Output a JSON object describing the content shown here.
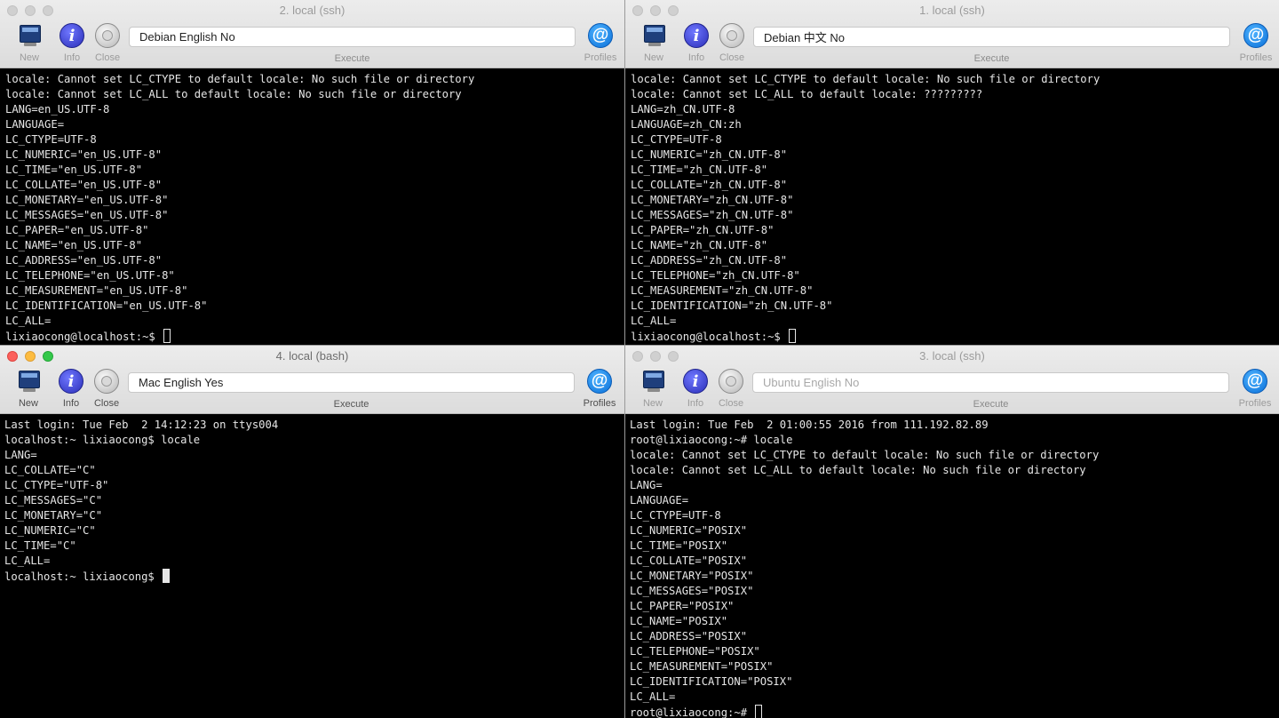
{
  "toolbar_labels": {
    "new": "New",
    "info": "Info",
    "close": "Close",
    "execute": "Execute",
    "profiles": "Profiles",
    "profiles_glyph": "@",
    "info_glyph": "i"
  },
  "windows": {
    "top_left": {
      "title": "2. local (ssh)",
      "command_value": "Debian English No",
      "command_placeholder": "",
      "lines": [
        "locale: Cannot set LC_CTYPE to default locale: No such file or directory",
        "locale: Cannot set LC_ALL to default locale: No such file or directory",
        "LANG=en_US.UTF-8",
        "LANGUAGE=",
        "LC_CTYPE=UTF-8",
        "LC_NUMERIC=\"en_US.UTF-8\"",
        "LC_TIME=\"en_US.UTF-8\"",
        "LC_COLLATE=\"en_US.UTF-8\"",
        "LC_MONETARY=\"en_US.UTF-8\"",
        "LC_MESSAGES=\"en_US.UTF-8\"",
        "LC_PAPER=\"en_US.UTF-8\"",
        "LC_NAME=\"en_US.UTF-8\"",
        "LC_ADDRESS=\"en_US.UTF-8\"",
        "LC_TELEPHONE=\"en_US.UTF-8\"",
        "LC_MEASUREMENT=\"en_US.UTF-8\"",
        "LC_IDENTIFICATION=\"en_US.UTF-8\"",
        "LC_ALL="
      ],
      "prompt": "lixiaocong@localhost:~$ "
    },
    "top_right": {
      "title": "1. local (ssh)",
      "command_value": "Debian 中文 No",
      "command_placeholder": "",
      "lines": [
        "locale: Cannot set LC_CTYPE to default locale: No such file or directory",
        "locale: Cannot set LC_ALL to default locale: ?????????",
        "LANG=zh_CN.UTF-8",
        "LANGUAGE=zh_CN:zh",
        "LC_CTYPE=UTF-8",
        "LC_NUMERIC=\"zh_CN.UTF-8\"",
        "LC_TIME=\"zh_CN.UTF-8\"",
        "LC_COLLATE=\"zh_CN.UTF-8\"",
        "LC_MONETARY=\"zh_CN.UTF-8\"",
        "LC_MESSAGES=\"zh_CN.UTF-8\"",
        "LC_PAPER=\"zh_CN.UTF-8\"",
        "LC_NAME=\"zh_CN.UTF-8\"",
        "LC_ADDRESS=\"zh_CN.UTF-8\"",
        "LC_TELEPHONE=\"zh_CN.UTF-8\"",
        "LC_MEASUREMENT=\"zh_CN.UTF-8\"",
        "LC_IDENTIFICATION=\"zh_CN.UTF-8\"",
        "LC_ALL="
      ],
      "prompt": "lixiaocong@localhost:~$ "
    },
    "bottom_left": {
      "title": "4. local (bash)",
      "command_value": "Mac English Yes",
      "command_placeholder": "",
      "lines": [
        "Last login: Tue Feb  2 14:12:23 on ttys004",
        "localhost:~ lixiaocong$ locale",
        "LANG=",
        "LC_COLLATE=\"C\"",
        "LC_CTYPE=\"UTF-8\"",
        "LC_MESSAGES=\"C\"",
        "LC_MONETARY=\"C\"",
        "LC_NUMERIC=\"C\"",
        "LC_TIME=\"C\"",
        "LC_ALL="
      ],
      "prompt": "localhost:~ lixiaocong$ "
    },
    "bottom_right": {
      "title": "3. local (ssh)",
      "command_value": "",
      "command_placeholder": "Ubuntu English No",
      "lines": [
        "Last login: Tue Feb  2 01:00:55 2016 from 111.192.82.89",
        "root@lixiaocong:~# locale",
        "locale: Cannot set LC_CTYPE to default locale: No such file or directory",
        "locale: Cannot set LC_ALL to default locale: No such file or directory",
        "LANG=",
        "LANGUAGE=",
        "LC_CTYPE=UTF-8",
        "LC_NUMERIC=\"POSIX\"",
        "LC_TIME=\"POSIX\"",
        "LC_COLLATE=\"POSIX\"",
        "LC_MONETARY=\"POSIX\"",
        "LC_MESSAGES=\"POSIX\"",
        "LC_PAPER=\"POSIX\"",
        "LC_NAME=\"POSIX\"",
        "LC_ADDRESS=\"POSIX\"",
        "LC_TELEPHONE=\"POSIX\"",
        "LC_MEASUREMENT=\"POSIX\"",
        "LC_IDENTIFICATION=\"POSIX\"",
        "LC_ALL="
      ],
      "prompt": "root@lixiaocong:~# "
    }
  },
  "colors": {
    "terminal_bg": "#000000",
    "terminal_fg": "#e6e6e6",
    "close_red": "#fc605c",
    "minimize_yellow": "#fdbc40",
    "zoom_green": "#34c84a"
  }
}
